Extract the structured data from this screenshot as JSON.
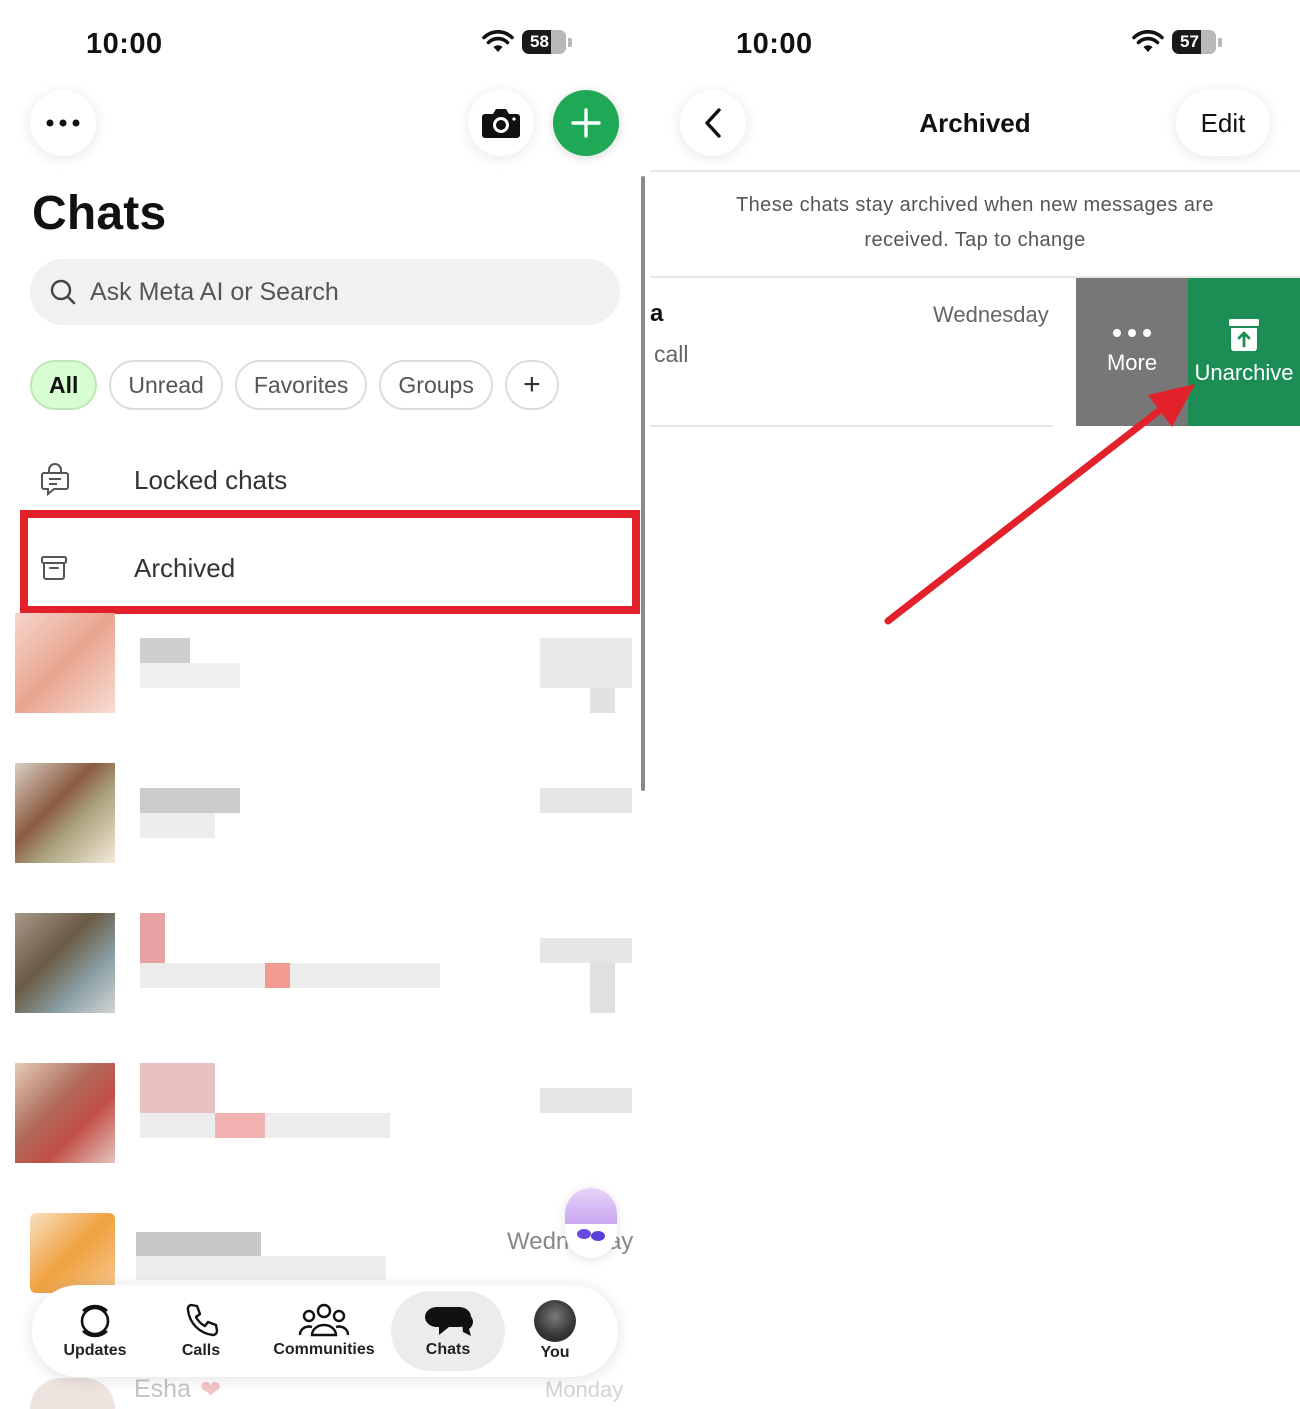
{
  "left": {
    "status": {
      "time": "10:00",
      "battery": "58"
    },
    "title": "Chats",
    "search": {
      "placeholder": "Ask Meta AI or Search"
    },
    "filters": [
      "All",
      "Unread",
      "Favorites",
      "Groups",
      "+"
    ],
    "locked_chats": "Locked chats",
    "archived": "Archived",
    "blurred_rows": [
      {
        "time": "Wednesday",
        "name": ""
      },
      {
        "time": "Monday",
        "name": "Esha"
      }
    ],
    "tabs": [
      {
        "label": "Updates",
        "icon": "updates-icon"
      },
      {
        "label": "Calls",
        "icon": "phone-icon"
      },
      {
        "label": "Communities",
        "icon": "communities-icon"
      },
      {
        "label": "Chats",
        "icon": "chats-icon"
      },
      {
        "label": "You",
        "icon": "avatar"
      }
    ],
    "colors": {
      "accent": "#1fa855",
      "highlight": "#e2212b",
      "chip_active_bg": "#d9fdd3"
    }
  },
  "right": {
    "status": {
      "time": "10:00",
      "battery": "57"
    },
    "nav": {
      "title": "Archived",
      "edit": "Edit"
    },
    "info": "These chats stay archived when new messages are received. Tap to change",
    "chat": {
      "name": "a",
      "message": "call",
      "time": "Wednesday"
    },
    "swipe": {
      "more": "More",
      "unarchive": "Unarchive"
    },
    "colors": {
      "more_bg": "#777777",
      "unarchive_bg": "#1c8d55",
      "arrow": "#e2212b"
    }
  }
}
